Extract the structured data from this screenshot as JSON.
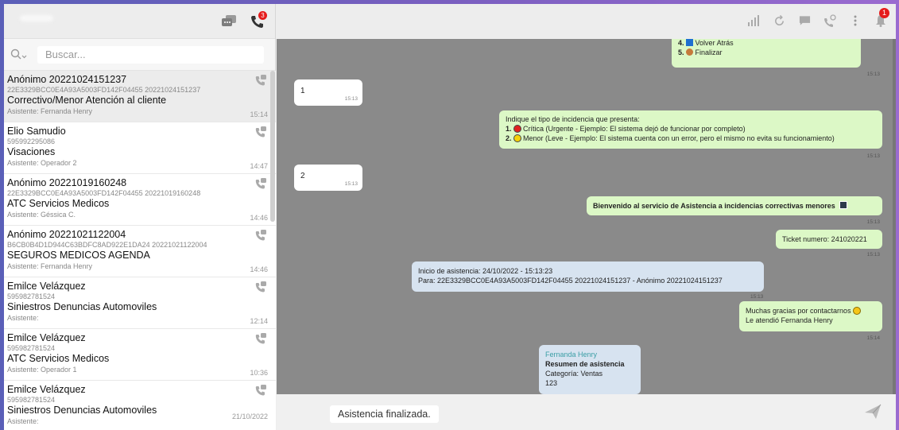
{
  "left_header": {
    "chat_badge": "",
    "calls_badge": "3"
  },
  "search": {
    "placeholder": "Buscar..."
  },
  "chats": [
    {
      "name": "Anónimo 20221024151237",
      "id": "22E3329BCC0E4A93A5003FD142F04455 20221024151237",
      "group": "Correctivo/Menor Atención al cliente",
      "assistant": "Asistente: Fernanda Henry",
      "time": "15:14",
      "active": true
    },
    {
      "name": "Elio Samudio",
      "id": "595992295086",
      "group": "Visaciones",
      "assistant": "Asistente: Operador 2",
      "time": "14:47"
    },
    {
      "name": "Anónimo 20221019160248",
      "id": "22E3329BCC0E4A93A5003FD142F04455 20221019160248",
      "group": "ATC Servicios Medicos",
      "assistant": "Asistente: Géssica C.",
      "time": "14:46"
    },
    {
      "name": "Anónimo 20221021122004",
      "id": "B6CB0B4D1D944C63BDFC8AD922E1DA24 20221021122004",
      "group": "SEGUROS MEDICOS AGENDA",
      "assistant": "Asistente: Fernanda Henry",
      "time": "14:46"
    },
    {
      "name": "Emilce Velázquez",
      "id": "595982781524",
      "group": "Siniestros Denuncias Automoviles",
      "assistant": "Asistente:",
      "time": "12:14"
    },
    {
      "name": "Emilce Velázquez",
      "id": "595982781524",
      "group": "ATC Servicios Medicos",
      "assistant": "Asistente: Operador 1",
      "time": "10:36"
    },
    {
      "name": "Emilce Velázquez",
      "id": "595982781524",
      "group": "Siniestros Denuncias Automoviles",
      "assistant": "Asistente:",
      "time": "21/10/2022"
    }
  ],
  "right_header": {
    "notification_badge": "1"
  },
  "messages": {
    "menu_4": "4.",
    "menu_4_text": "Volver Atrás",
    "menu_5": "5.",
    "menu_5_text": "Finalizar",
    "menu_time": "15:13",
    "in1_text": "1",
    "in1_time": "15:13",
    "incid_title": "Indique el tipo de incidencia que presenta:",
    "incid_1": "1.",
    "incid_1_text": "Crítica (Urgente - Ejemplo: El sistema dejó de funcionar por completo)",
    "incid_2": "2.",
    "incid_2_text": "Menor (Leve - Ejemplo: El sistema cuenta con un error, pero el mismo no evita su funcionamiento)",
    "incid_time": "15:13",
    "in2_text": "2",
    "in2_time": "15:13",
    "welcome_text": "Bienvenido al servicio de Asistencia a incidencias correctivas menores",
    "welcome_time": "15:13",
    "ticket_text": "Ticket numero: 241020221",
    "ticket_time": "15:13",
    "sys_line1": "Inicio de asistencia: 24/10/2022 - 15:13:23",
    "sys_line2": "Para: 22E3329BCC0E4A93A5003FD142F04455 20221024151237 - Anónimo 20221024151237",
    "sys_time": "15:13",
    "thanks_line1": "Muchas gracias por contactarnos",
    "thanks_line2": "Le atendió Fernanda Henry",
    "thanks_time": "15:14",
    "summary_agent": "Fernanda Henry",
    "summary_title": "Resumen de asistencia",
    "summary_cat": "Categoría: Ventas",
    "summary_val": "123"
  },
  "composer": {
    "text": "Asistencia finalizada."
  },
  "colors": {
    "accent_green": "#dcf8c6",
    "system_blue": "#d7e3f0",
    "badge_red": "#e51b1b",
    "agent_teal": "#3a9ea5"
  }
}
